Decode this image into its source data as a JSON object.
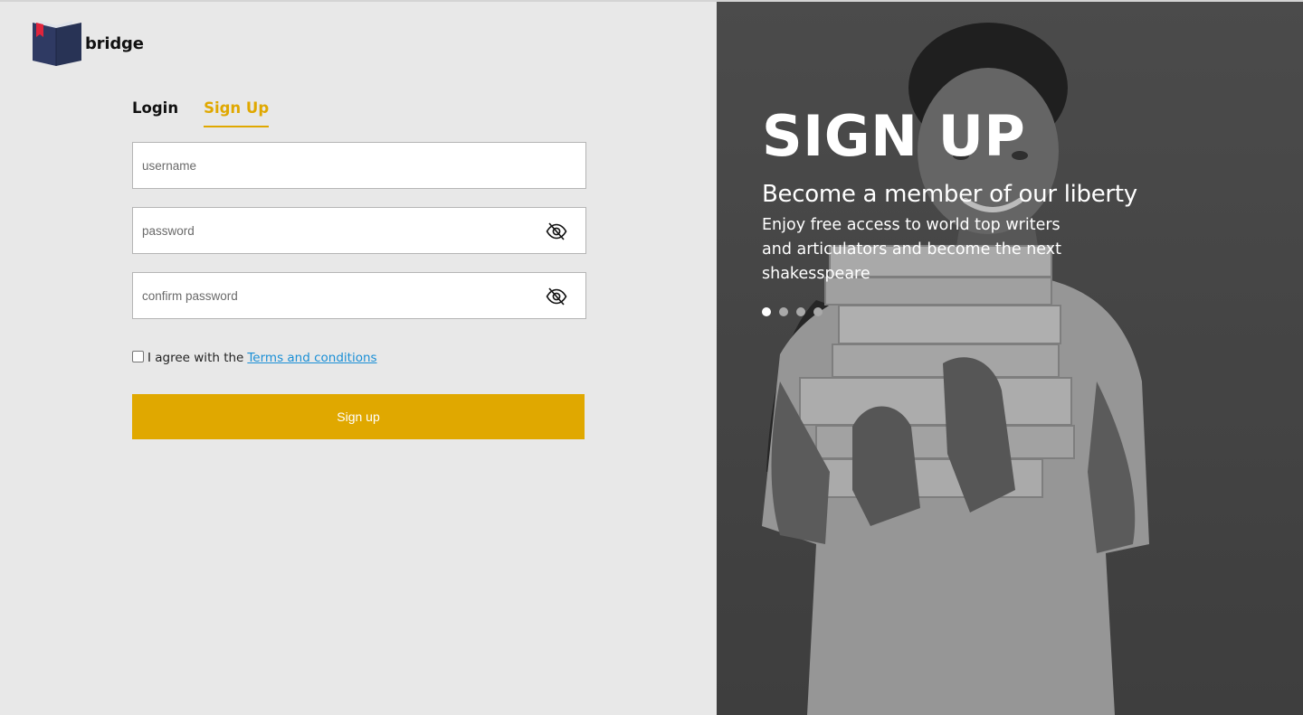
{
  "brand": {
    "name": "bridge"
  },
  "tabs": [
    {
      "label": "Login",
      "active": false
    },
    {
      "label": "Sign Up",
      "active": true
    }
  ],
  "form": {
    "username_placeholder": "username",
    "password_placeholder": "password",
    "confirm_placeholder": "confirm password",
    "agree_text": "I agree with the",
    "terms_link": "Terms and conditions",
    "submit_label": "Sign up"
  },
  "hero": {
    "title": "SIGN UP",
    "subtitle": "Become a member of our liberty",
    "description": "Enjoy free access to world top writers and articulators and become the next shakesspeare",
    "slides_total": 4,
    "active_slide": 1
  },
  "colors": {
    "accent": "#e0a800",
    "link": "#1a8fd6",
    "panel_bg": "#e8e8e8",
    "hero_bg": "#575757",
    "logo_book": "#2f3a63",
    "logo_bookmark": "#e0243c"
  },
  "icons": {
    "password_toggle": "eye-slash-icon",
    "confirm_toggle": "eye-slash-icon",
    "logo": "book-icon"
  }
}
